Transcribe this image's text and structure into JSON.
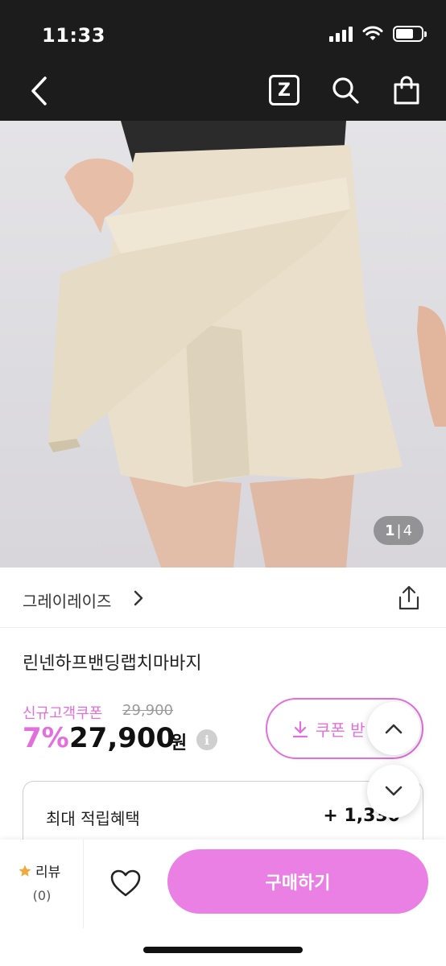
{
  "status_bar": {
    "time": "11:33"
  },
  "nav": {
    "z_label": "Z"
  },
  "gallery": {
    "current": "1",
    "separator": "|",
    "total": "4"
  },
  "brand": {
    "name": "그레이레이즈"
  },
  "product": {
    "title": "린넨하프밴딩랩치마바지"
  },
  "pricing": {
    "coupon_label": "신규고객쿠폰",
    "original_price": "29,900",
    "discount": "7%",
    "final_price": "27,900",
    "currency": "원",
    "info": "i",
    "coupon_button_label": "쿠폰 받"
  },
  "reward": {
    "label": "최대 적립혜택",
    "value": "+ 1,330"
  },
  "bottom": {
    "review_label": "리뷰",
    "review_count": "(0)",
    "buy_label": "구매하기"
  },
  "colors": {
    "accent": "#e46fdc",
    "buy": "#ea80e4",
    "header": "#1c1c1c"
  }
}
